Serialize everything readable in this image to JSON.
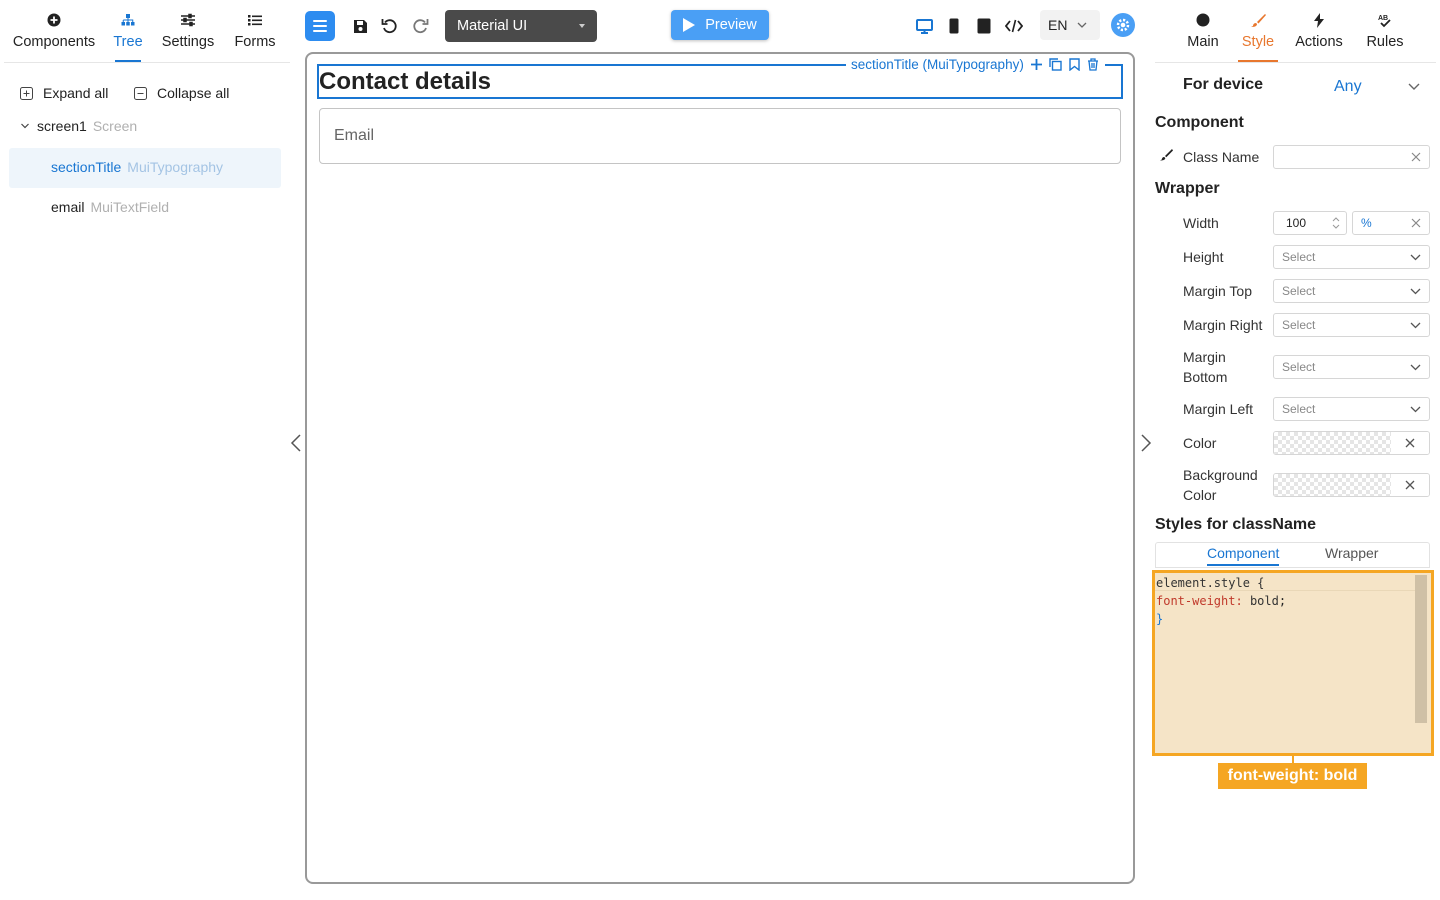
{
  "left_tabs": [
    {
      "label": "Components",
      "icon": "plus-circle-icon"
    },
    {
      "label": "Tree",
      "icon": "tree-icon"
    },
    {
      "label": "Settings",
      "icon": "sliders-icon"
    },
    {
      "label": "Forms",
      "icon": "list-icon"
    }
  ],
  "tree": {
    "expand_all": "Expand all",
    "collapse_all": "Collapse all",
    "screen": {
      "name": "screen1",
      "type": "Screen"
    },
    "items": [
      {
        "name": "sectionTitle",
        "type": "MuiTypography"
      },
      {
        "name": "email",
        "type": "MuiTextField"
      }
    ]
  },
  "toolbar": {
    "framework": "Material UI",
    "preview": "Preview",
    "language": "EN"
  },
  "canvas": {
    "selected_label": "sectionTitle (MuiTypography)",
    "title": "Contact details",
    "email_placeholder": "Email"
  },
  "right_tabs": [
    {
      "label": "Main",
      "icon": "circle-icon"
    },
    {
      "label": "Style",
      "icon": "brush-icon"
    },
    {
      "label": "Actions",
      "icon": "lightning-icon"
    },
    {
      "label": "Rules",
      "icon": "rules-icon"
    }
  ],
  "style": {
    "for_device_label": "For device",
    "for_device_value": "Any",
    "component_heading": "Component",
    "class_name_label": "Class Name",
    "class_name_value": "",
    "wrapper_heading": "Wrapper",
    "width_label": "Width",
    "width_value": "100",
    "width_unit": "%",
    "height_label": "Height",
    "margin_top_label": "Margin Top",
    "margin_right_label": "Margin Right",
    "margin_bottom_label_1": "Margin",
    "margin_bottom_label_2": "Bottom",
    "margin_left_label": "Margin Left",
    "color_label": "Color",
    "bg_color_label_1": "Background",
    "bg_color_label_2": "Color",
    "select_placeholder": "Select",
    "styles_heading": "Styles for className",
    "subtabs": [
      "Component",
      "Wrapper"
    ],
    "css_line1": "element.style {",
    "css_prop": "font-weight",
    "css_value": "bold",
    "css_line3": "}",
    "annotation": "font-weight: bold"
  },
  "colors": {
    "accent": "#1976d2",
    "style_accent": "#e8772e",
    "highlight": "#f5a623",
    "preview": "#4a9ff5"
  }
}
